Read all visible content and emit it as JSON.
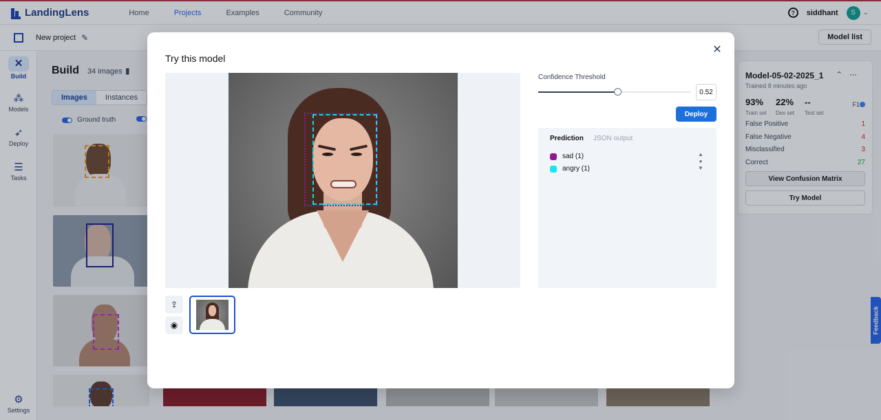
{
  "nav": {
    "brand": "LandingLens",
    "links": [
      "Home",
      "Projects",
      "Examples",
      "Community"
    ],
    "active_link": "Projects",
    "user_name": "siddhant",
    "avatar_initial": "S"
  },
  "subbar": {
    "project_name": "New project",
    "model_list_label": "Model list"
  },
  "sidebar": {
    "items": [
      {
        "label": "Build",
        "icon": "tools-icon"
      },
      {
        "label": "Models",
        "icon": "network-icon"
      },
      {
        "label": "Deploy",
        "icon": "rocket-icon"
      },
      {
        "label": "Tasks",
        "icon": "list-icon"
      },
      {
        "label": "Settings",
        "icon": "gear-icon"
      }
    ]
  },
  "build": {
    "title": "Build",
    "image_count": "34 images",
    "tabs": [
      "Images",
      "Instances"
    ],
    "active_tab": "Images",
    "ground_truth_label": "Ground truth"
  },
  "model_panel": {
    "model_name": "Model-05-02-2025_1",
    "trained": "Trained 8 minutes ago",
    "metrics": [
      {
        "value": "93%",
        "label": "Train set"
      },
      {
        "value": "22%",
        "label": "Dev set"
      },
      {
        "value": "--",
        "label": "Test set"
      }
    ],
    "f1_label": "F1",
    "rows": [
      {
        "label": "False Positive",
        "value": "1",
        "color": "#dc2626"
      },
      {
        "label": "False Negative",
        "value": "4",
        "color": "#dc2626"
      },
      {
        "label": "Misclassified",
        "value": "3",
        "color": "#dc2626"
      },
      {
        "label": "Correct",
        "value": "27",
        "color": "#16a34a"
      }
    ],
    "confusion_button": "View Confusion Matrix",
    "try_button": "Try Model"
  },
  "feedback_label": "Feedback",
  "modal": {
    "title": "Try this model",
    "confidence_label": "Confidence Threshold",
    "confidence_value": "0.52",
    "confidence_fraction": 0.52,
    "deploy_label": "Deploy",
    "prediction_tab": "Prediction",
    "json_tab": "JSON output",
    "predictions": [
      {
        "label": "sad (1)",
        "color": "#8e1a8e"
      },
      {
        "label": "angry (1)",
        "color": "#10e8f0"
      }
    ]
  }
}
